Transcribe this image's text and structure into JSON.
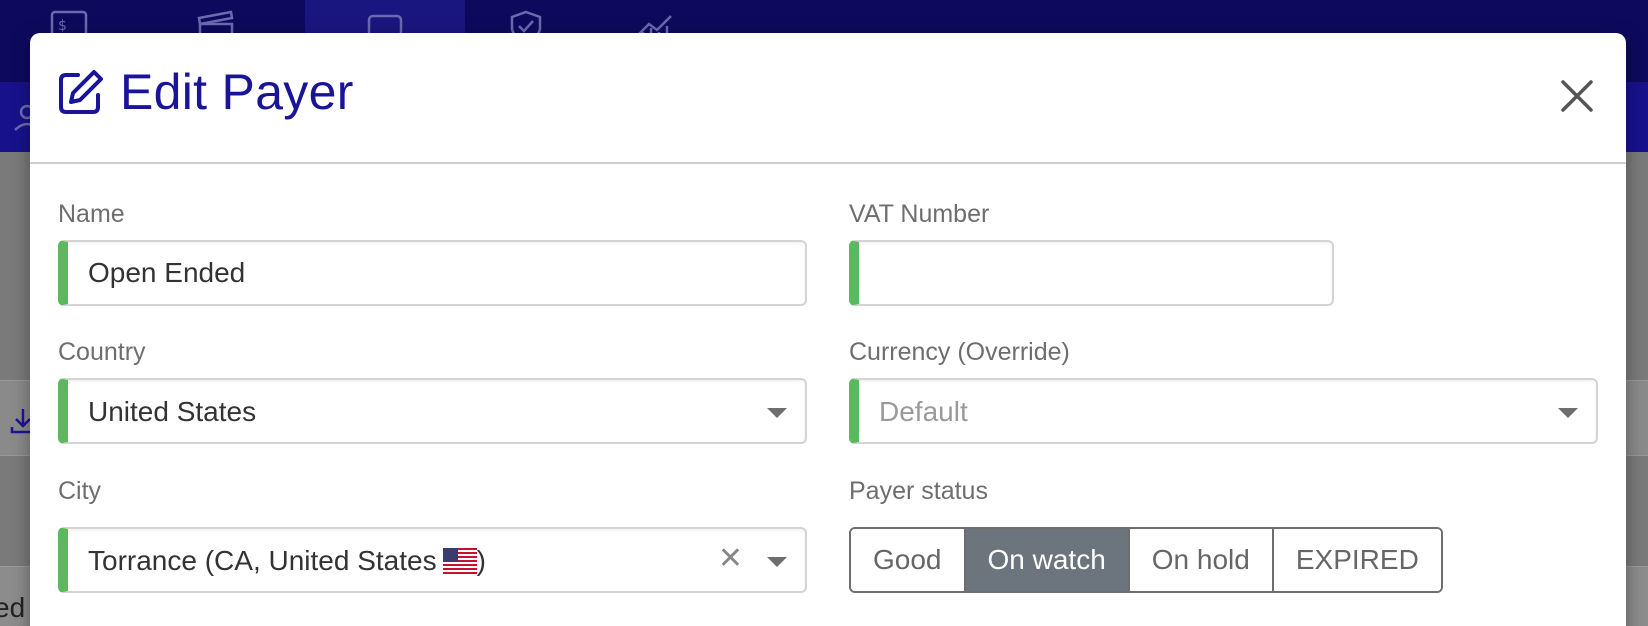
{
  "modal": {
    "title": "Edit Payer",
    "close_icon": "close-icon",
    "title_icon": "edit-icon"
  },
  "fields": {
    "name": {
      "label": "Name",
      "value": "Open Ended"
    },
    "vat": {
      "label": "VAT Number",
      "value": ""
    },
    "country": {
      "label": "Country",
      "value": "United States"
    },
    "currency": {
      "label": "Currency (Override)",
      "value": "Default"
    },
    "city": {
      "label": "City",
      "value": "Torrance (CA, United States",
      "value_suffix": ")",
      "flag": "us-flag-icon"
    },
    "payer_status": {
      "label": "Payer status",
      "options": [
        "Good",
        "On watch",
        "On hold",
        "EXPIRED"
      ],
      "selected": "On watch"
    }
  },
  "background": {
    "fragment_text": "ed"
  },
  "colors": {
    "nav_bg": "#0d0a5e",
    "title": "#1a1496",
    "valid_accent": "#5cb85c",
    "active_status": "#6c757d"
  }
}
